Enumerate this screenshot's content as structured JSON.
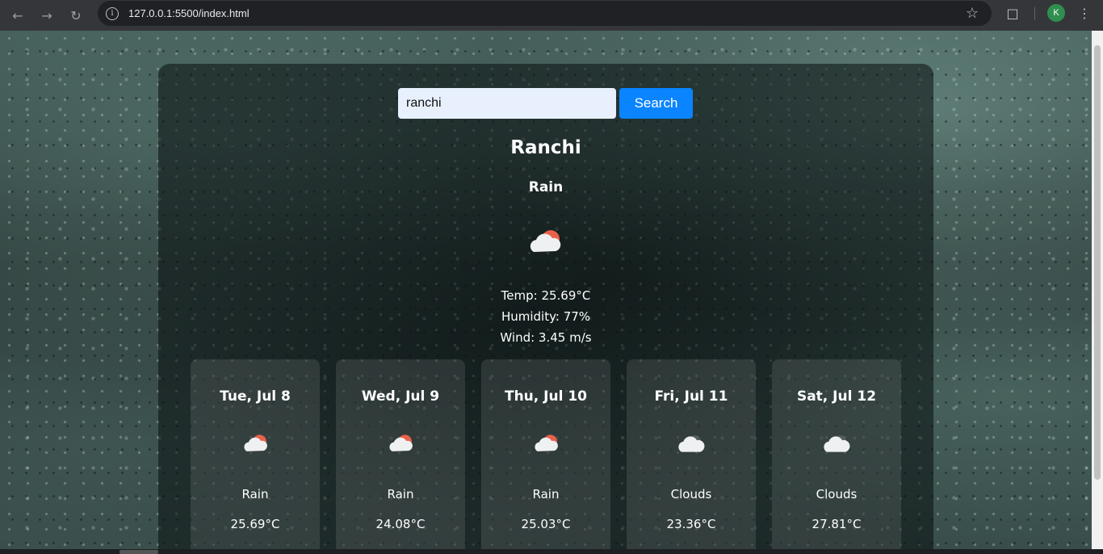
{
  "browser": {
    "url": "127.0.0.1:5500/index.html",
    "profile_initial": "K"
  },
  "search": {
    "value": "ranchi",
    "button_label": "Search"
  },
  "current": {
    "city": "Ranchi",
    "condition": "Rain",
    "icon": "cloud-sun-icon",
    "temp": "Temp: 25.69°C",
    "humidity": "Humidity: 77%",
    "wind": "Wind: 3.45 m/s"
  },
  "forecast": [
    {
      "date": "Tue, Jul 8",
      "icon": "cloud-sun-icon",
      "condition": "Rain",
      "temp": "25.69°C"
    },
    {
      "date": "Wed, Jul 9",
      "icon": "cloud-sun-icon",
      "condition": "Rain",
      "temp": "24.08°C"
    },
    {
      "date": "Thu, Jul 10",
      "icon": "cloud-sun-icon",
      "condition": "Rain",
      "temp": "25.03°C"
    },
    {
      "date": "Fri, Jul 11",
      "icon": "cloud-icon",
      "condition": "Clouds",
      "temp": "23.36°C"
    },
    {
      "date": "Sat, Jul 12",
      "icon": "cloud-icon",
      "condition": "Clouds",
      "temp": "27.81°C"
    }
  ],
  "colors": {
    "search_button": "#0a84ff",
    "sun": "#e8624a"
  }
}
